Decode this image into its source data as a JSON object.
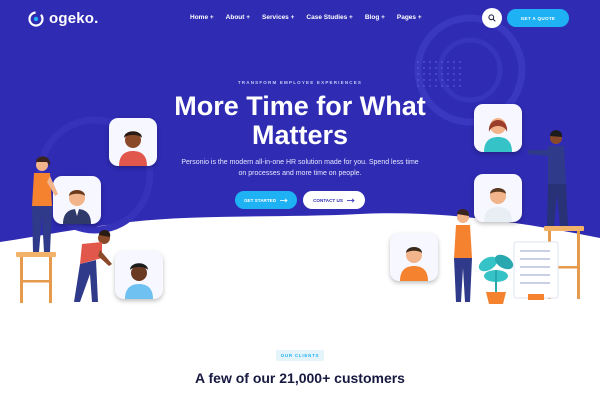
{
  "brand": {
    "name": "ogeko."
  },
  "nav": {
    "items": [
      {
        "label": "Home +"
      },
      {
        "label": "About +"
      },
      {
        "label": "Services +"
      },
      {
        "label": "Case Studies +"
      },
      {
        "label": "Blog +"
      },
      {
        "label": "Pages +"
      }
    ],
    "search_icon": "search-icon",
    "quote_label": "GET A QUOTE"
  },
  "hero": {
    "eyebrow": "TRANSFORM EMPLOYEE EXPERIENCES",
    "title": "More Time for What Matters",
    "subtitle": "Personio is the modern all-in-one HR solution made for you. Spend less time on processes and more time on people.",
    "primary_cta": "GET STARTED",
    "secondary_cta": "CONTACT US"
  },
  "clients": {
    "badge": "OUR CLIENTS",
    "title": "A few of our 21,000+ customers"
  },
  "colors": {
    "hero_bg": "#2f2bb3",
    "accent": "#1eb2f5",
    "heading_dark": "#171940",
    "white": "#ffffff"
  }
}
